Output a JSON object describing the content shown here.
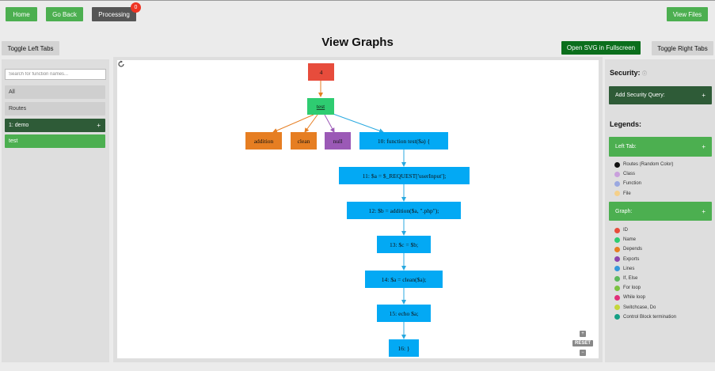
{
  "topbar": {
    "home": "Home",
    "go_back": "Go Back",
    "processing": "Processing",
    "processing_count": "0",
    "view_files": "View Files"
  },
  "header": {
    "toggle_left": "Toggle Left Tabs",
    "title": "View Graphs",
    "open_svg": "Open SVG in Fullscreen",
    "toggle_right": "Toggle Right Tabs"
  },
  "left": {
    "search_placeholder": "Search for function names...",
    "items": [
      {
        "label": "All"
      },
      {
        "label": "Routes"
      },
      {
        "label": "1: demo",
        "plus": "+"
      },
      {
        "label": "test"
      }
    ]
  },
  "graph": {
    "nodes": {
      "id": "4",
      "name": "test",
      "dep_addition": "addition",
      "dep_clean": "clean",
      "export_null": "null",
      "l10": "10: function test($a) {",
      "l11": "11: $a = $_REQUEST['userInput'];",
      "l12": "12: $b = addition($a, \".php\");",
      "l13": "13: $c = $b;",
      "l14": "14: $a = clean($a);",
      "l15": "15: echo $a;",
      "l16": "16: }"
    },
    "reset": "RESET",
    "zoom_in": "+",
    "zoom_out": "−"
  },
  "right": {
    "security_title": "Security:",
    "add_security": "Add Security Query:",
    "plus": "+",
    "legends_title": "Legends:",
    "left_tab": "Left Tab:",
    "left_legend": [
      {
        "label": "Routes (Random Color)",
        "color": "#111111"
      },
      {
        "label": "Class",
        "color": "#c9a0dc"
      },
      {
        "label": "Function",
        "color": "#9aa8e0"
      },
      {
        "label": "File",
        "color": "#f5d08a"
      }
    ],
    "graph_tab": "Graph:",
    "graph_legend": [
      {
        "label": "ID",
        "color": "#e74c3c"
      },
      {
        "label": "Name",
        "color": "#2ecc71"
      },
      {
        "label": "Depends",
        "color": "#e67e22"
      },
      {
        "label": "Exports",
        "color": "#8e44ad"
      },
      {
        "label": "Lines",
        "color": "#3498db"
      },
      {
        "label": "If, Else",
        "color": "#5cb85c"
      },
      {
        "label": "For loop",
        "color": "#7cc242"
      },
      {
        "label": "While loop",
        "color": "#e0307a"
      },
      {
        "label": "Switchcase, Do",
        "color": "#c5d63a"
      },
      {
        "label": "Control Block termination",
        "color": "#16a085"
      }
    ]
  }
}
